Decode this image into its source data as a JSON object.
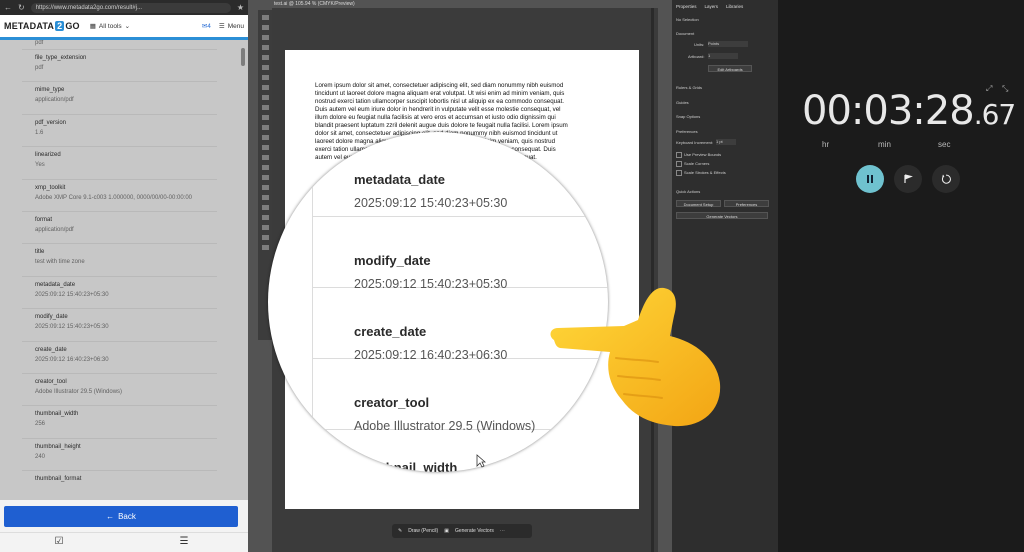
{
  "browser": {
    "url": "https://www.metadata2go.com/result#j...",
    "logo_prefix": "METADATA",
    "logo_mid": "2",
    "logo_suffix": "GO",
    "all_tools_label": "All tools",
    "notification_count": "4",
    "menu_label": "Menu",
    "partial_top_value": "pdf",
    "items": [
      {
        "key": "file_type_extension",
        "value": "pdf"
      },
      {
        "key": "mime_type",
        "value": "application/pdf"
      },
      {
        "key": "pdf_version",
        "value": "1.6"
      },
      {
        "key": "linearized",
        "value": "Yes"
      },
      {
        "key": "xmp_toolkit",
        "value": "Adobe XMP Core 9.1-c003 1.000000, 0000/00/00-00:00:00"
      },
      {
        "key": "format",
        "value": "application/pdf"
      },
      {
        "key": "title",
        "value": "test with time zone"
      },
      {
        "key": "metadata_date",
        "value": "2025:09:12 15:40:23+05:30"
      },
      {
        "key": "modify_date",
        "value": "2025:09:12 15:40:23+05:30"
      },
      {
        "key": "create_date",
        "value": "2025:09:12 16:40:23+06:30"
      },
      {
        "key": "creator_tool",
        "value": "Adobe Illustrator 29.5 (Windows)"
      },
      {
        "key": "thumbnail_width",
        "value": "256"
      },
      {
        "key": "thumbnail_height",
        "value": "240"
      },
      {
        "key": "thumbnail_format",
        "value": ""
      }
    ],
    "back_label": "Back"
  },
  "illustrator": {
    "tab_title": "test.ai @ 105.94 % (CMYK/Preview)",
    "lorem": "Lorem ipsum dolor sit amet, consectetuer adipiscing elit, sed diam nonummy nibh euismod tincidunt ut laoreet dolore magna aliquam erat volutpat. Ut wisi enim ad minim veniam, quis nostrud exerci tation ullamcorper suscipit lobortis nisl ut aliquip ex ea commodo consequat. Duis autem vel eum iriure dolor in hendrerit in vulputate velit esse molestie consequat, vel illum dolore eu feugiat nulla facilisis at vero eros et accumsan et iusto odio dignissim qui blandit praesent luptatum zzril delenit augue duis dolore te feugait nulla facilisi. Lorem ipsum dolor sit amet, consectetuer adipiscing elit, sed diam nonummy nibh euismod tincidunt ut laoreet dolore magna aliquam erat volutpat. Ut wisi enim ad minim veniam, quis nostrud exerci tation ullamcorper suscipit lobortis nisl ut aliquip ex ea commodo consequat. Duis autem vel eum iriure dolor in hendrerit in vulputate velit esse molestie consequat.",
    "bottom_tool_draw": "Draw (Pencil)",
    "bottom_tool_vectors": "Generate Vectors",
    "props": {
      "tabs": [
        "Properties",
        "Layers",
        "Libraries"
      ],
      "no_selection": "No Selection",
      "document": "Document",
      "units_label": "Units:",
      "units_value": "Points",
      "artboard_label": "Artboard:",
      "artboard_value": "1",
      "edit_artboards": "Edit Artboards",
      "rulers_grids": "Rulers & Grids",
      "guides": "Guides",
      "snap_options": "Snap Options",
      "preferences_section": "Preferences",
      "keyboard_increment_label": "Keyboard Increment:",
      "keyboard_increment_value": "1 pt",
      "use_preview_bounds": "Use Preview Bounds",
      "scale_corners": "Scale Corners",
      "scale_strokes": "Scale Strokes & Effects",
      "quick_actions": "Quick Actions",
      "document_setup": "Document Setup",
      "preferences_button": "Preferences",
      "generate_vectors": "Generate Vectors"
    }
  },
  "magnifier": {
    "items": [
      {
        "key": "metadata_date",
        "value": "2025:09:12 15:40:23+05:30"
      },
      {
        "key": "modify_date",
        "value": "2025:09:12 15:40:23+05:30"
      },
      {
        "key": "create_date",
        "value": "2025:09:12 16:40:23+06:30"
      },
      {
        "key": "creator_tool",
        "value": "Adobe Illustrator 29.5 (Windows)"
      },
      {
        "key": "thumbnail_width",
        "value": ""
      }
    ]
  },
  "timer": {
    "hours": "00",
    "minutes": "03",
    "seconds": "28",
    "centiseconds": "67",
    "hr_label": "hr",
    "min_label": "min",
    "sec_label": "sec",
    "accent_color": "#6fc2cf"
  }
}
